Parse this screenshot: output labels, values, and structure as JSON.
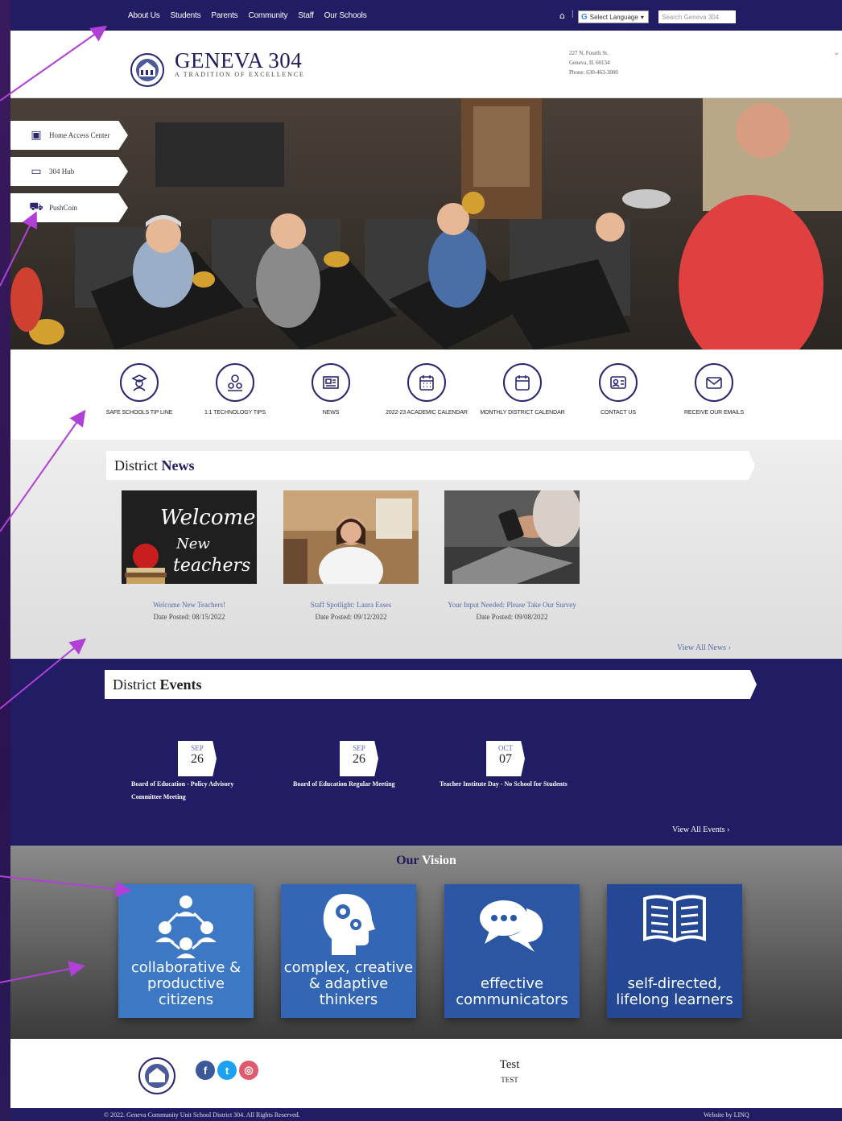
{
  "topbar": {
    "nav": [
      "About Us",
      "Students",
      "Parents",
      "Community",
      "Staff",
      "Our Schools"
    ],
    "language_label": "Select Language",
    "search_placeholder": "Search Geneva 304"
  },
  "header": {
    "logo_text": "GENEVA",
    "brand": "GENEVA 304",
    "tagline": "A TRADITION OF EXCELLENCE",
    "address_line1": "227 N. Fourth St.",
    "address_line2": "Geneva, IL 60134",
    "phone": "Phone: 630-463-3000"
  },
  "quick_links": [
    "Home Access Center",
    "304 Hub",
    "PushCoin"
  ],
  "icon_row": [
    {
      "label": "SAFE SCHOOLS TIP LINE",
      "icon": "student-icon"
    },
    {
      "label": "1:1 TECHNOLOGY TIPS",
      "icon": "users-icon"
    },
    {
      "label": "NEWS",
      "icon": "newspaper-icon"
    },
    {
      "label": "2022-23 ACADEMIC CALENDAR",
      "icon": "calendar-grid-icon"
    },
    {
      "label": "MONTHLY DISTRICT CALENDAR",
      "icon": "calendar-icon"
    },
    {
      "label": "CONTACT US",
      "icon": "contact-card-icon"
    },
    {
      "label": "RECEIVE OUR EMAILS",
      "icon": "envelope-icon"
    }
  ],
  "news": {
    "heading_a": "District",
    "heading_b": "News",
    "welcome_chalk": [
      "Welcome!",
      "New",
      "teachers"
    ],
    "items": [
      {
        "title": "Welcome New Teachers!",
        "date": "Date Posted: 08/15/2022"
      },
      {
        "title": "Staff Spotlight: Laura Esses",
        "date": "Date Posted: 09/12/2022"
      },
      {
        "title": "Your Input Needed: Please Take Our Survey",
        "date": "Date Posted: 09/08/2022"
      }
    ],
    "view_all": "View All News"
  },
  "events": {
    "heading_a": "District",
    "heading_b": "Events",
    "items": [
      {
        "month": "SEP",
        "day": "26",
        "title": "Board of Education - Policy Advisory Committee Meeting"
      },
      {
        "month": "SEP",
        "day": "26",
        "title": "Board of Education Regular Meeting"
      },
      {
        "month": "OCT",
        "day": "07",
        "title": "Teacher Institute Day - No School for Students"
      }
    ],
    "view_all": "View All Events"
  },
  "vision": {
    "heading_a": "Our",
    "heading_b": "Vision",
    "tiles": [
      {
        "text": "collaborative & productive citizens",
        "color": "#3d78c4",
        "icon": "people-network-icon"
      },
      {
        "text": "complex, creative & adaptive thinkers",
        "color": "#3366b4",
        "icon": "head-gears-icon"
      },
      {
        "text": "effective communicators",
        "color": "#2a56a4",
        "icon": "speech-bubbles-icon"
      },
      {
        "text": "self-directed, lifelong learners",
        "color": "#244893",
        "icon": "open-book-icon"
      }
    ]
  },
  "footer": {
    "test_title": "Test",
    "test_sub": "TEST",
    "copyright": "© 2022. Geneva Community Unit School District 304. All Rights Reserved.",
    "credit": "Website by LINQ"
  },
  "colors": {
    "navy": "#221c64",
    "link": "#5b6aa6",
    "annotation": "#b040d8"
  }
}
